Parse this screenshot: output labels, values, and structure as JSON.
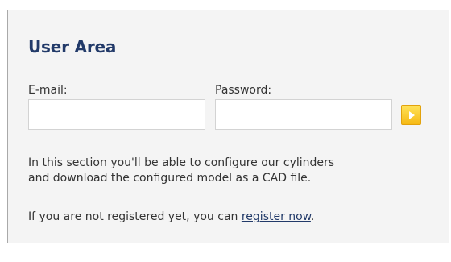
{
  "panel": {
    "title": "User Area",
    "email_label": "E-mail:",
    "email_value": "",
    "password_label": "Password:",
    "password_value": "",
    "submit_icon": "arrow-right-icon",
    "description_line1": "In this section you'll be able to configure our cylinders",
    "description_line2": "and download the configured model as a CAD file.",
    "register_prefix": "If you are not registered yet, you can ",
    "register_link": "register now",
    "register_suffix": "."
  },
  "colors": {
    "title": "#223a69",
    "panel_bg": "#f4f4f4",
    "button_accent": "#f6b914"
  }
}
